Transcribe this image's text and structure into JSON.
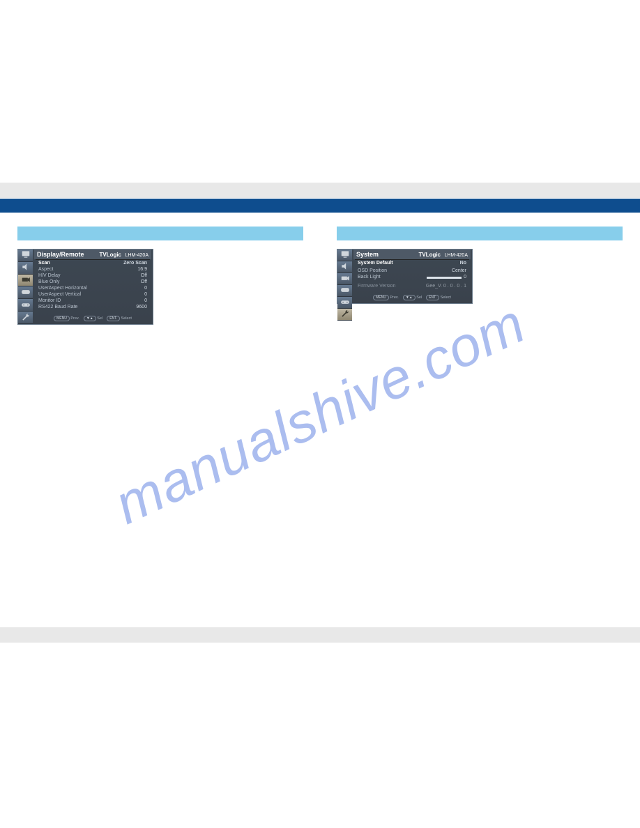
{
  "bands": {},
  "watermark": {
    "text": "manualshive.com"
  },
  "left_panel": {
    "title": "Display/Remote",
    "brand": "TVLogic",
    "model": "LHM-420A",
    "rows": [
      {
        "l": "Scan",
        "v": "Zero Scan",
        "sel": true
      },
      {
        "l": "Aspect",
        "v": "16:9"
      },
      {
        "l": "H/V Delay",
        "v": "Off"
      },
      {
        "l": "Blue Only",
        "v": "Off"
      },
      {
        "l": "UserAspect Horizontal",
        "v": "0"
      },
      {
        "l": "UserAspect Vertical",
        "v": "0"
      },
      {
        "l": "Monitor ID",
        "v": "0"
      },
      {
        "l": "RS422 Baud Rate",
        "v": "9600"
      }
    ],
    "footer": {
      "menu": "MENU",
      "menu_t": "Prev.",
      "arrows": "▼▲",
      "arrows_t": "Sel",
      "ent": "ENT.",
      "ent_t": "Select"
    }
  },
  "right_panel": {
    "title": "System",
    "brand": "TVLogic",
    "model": "LHM-420A",
    "rows": [
      {
        "l": "System Default",
        "v": "No",
        "sel": true
      },
      {
        "l": "",
        "v": ""
      },
      {
        "l": "OSD Position",
        "v": "Center"
      },
      {
        "l": "Back Light",
        "v": "0",
        "slider": true
      },
      {
        "l": "",
        "v": ""
      },
      {
        "l": "",
        "v": ""
      },
      {
        "l": "Firmware Version",
        "v": "Gee_V. 0 . 0 . 0 . 1",
        "dim": true
      }
    ],
    "footer": {
      "menu": "MENU",
      "menu_t": "Prev.",
      "arrows": "▼▲",
      "arrows_t": "Sel",
      "ent": "ENT.",
      "ent_t": "Select"
    }
  },
  "icons": {
    "monitor": "monitor-icon",
    "speaker": "speaker-icon",
    "camera": "camera-icon",
    "console": "console-icon",
    "tools": "tools-icon",
    "wrench": "wrench-icon"
  }
}
